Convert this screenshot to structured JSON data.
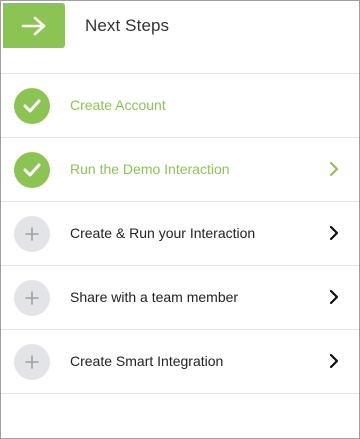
{
  "header": {
    "title": "Next Steps",
    "arrow_icon": "arrow-right-icon"
  },
  "colors": {
    "accent_green": "#8bc453",
    "pending_gray": "#e3e4e6",
    "text_dark": "#222222"
  },
  "steps": [
    {
      "label": "Create Account",
      "status": "complete",
      "icon": "checkmark-icon",
      "has_chevron": false
    },
    {
      "label": "Run the Demo Interaction",
      "status": "complete",
      "icon": "checkmark-icon",
      "has_chevron": true
    },
    {
      "label": "Create & Run your Interaction",
      "status": "pending",
      "icon": "plus-icon",
      "has_chevron": true
    },
    {
      "label": "Share with a team member",
      "status": "pending",
      "icon": "plus-icon",
      "has_chevron": true
    },
    {
      "label": "Create Smart Integration",
      "status": "pending",
      "icon": "plus-icon",
      "has_chevron": true
    }
  ]
}
